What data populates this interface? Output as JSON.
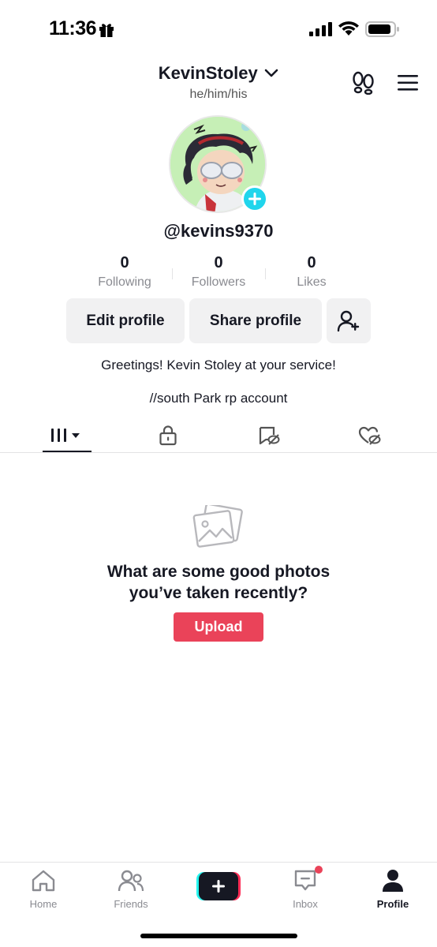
{
  "status_bar": {
    "time": "11:36",
    "icons": [
      "gift-icon",
      "signal-icon",
      "wifi-icon",
      "battery-icon"
    ]
  },
  "header": {
    "username": "KevinStoley",
    "pronouns": "he/him/his",
    "icons": [
      "chevron-down-icon",
      "footprint-icon",
      "menu-icon"
    ]
  },
  "profile": {
    "handle": "@kevins9370",
    "stats": [
      {
        "value": "0",
        "label": "Following"
      },
      {
        "value": "0",
        "label": "Followers"
      },
      {
        "value": "0",
        "label": "Likes"
      }
    ],
    "edit_label": "Edit profile",
    "share_label": "Share profile",
    "bio_line1": "Greetings! Kevin Stoley at your service!",
    "bio_line2": "//south Park rp account"
  },
  "tabs": [
    {
      "icon": "grid-icon",
      "active": true
    },
    {
      "icon": "lock-icon",
      "active": false
    },
    {
      "icon": "hidden-repost-icon",
      "active": false
    },
    {
      "icon": "hidden-heart-icon",
      "active": false
    }
  ],
  "empty_state": {
    "title_line1": "What are some good photos",
    "title_line2": "you’ve taken recently?",
    "upload_label": "Upload"
  },
  "bottom_nav": [
    {
      "label": "Home",
      "icon": "home-icon"
    },
    {
      "label": "Friends",
      "icon": "friends-icon"
    },
    {
      "label": "",
      "icon": "plus-icon"
    },
    {
      "label": "Inbox",
      "icon": "inbox-icon"
    },
    {
      "label": "Profile",
      "icon": "profile-icon"
    }
  ],
  "colors": {
    "accent": "#ea4359",
    "cyan": "#20d5ec",
    "text": "#161823",
    "muted": "#8a8b91"
  }
}
